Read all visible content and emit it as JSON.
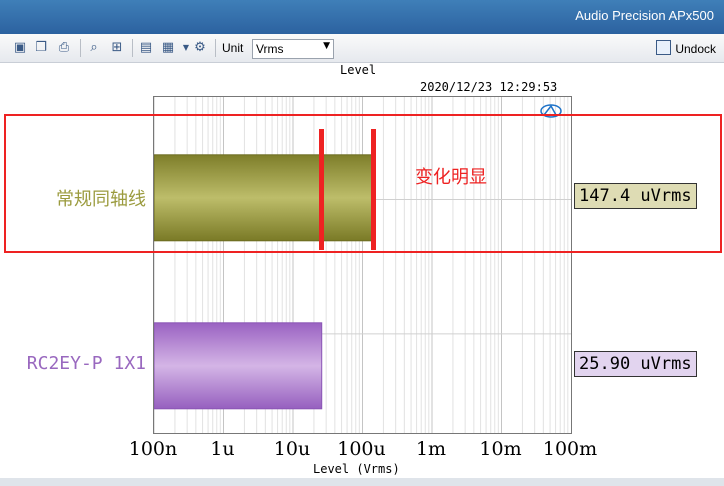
{
  "app": {
    "title": "Audio Precision APx500"
  },
  "toolbar": {
    "icons": [
      "save-icon",
      "copy-icon",
      "print-icon",
      "zoom-icon",
      "fit-icon",
      "table-icon",
      "chart-icon",
      "properties-icon"
    ],
    "unit_label": "Unit",
    "unit_value": "Vrms",
    "undock_label": "Undock"
  },
  "graph": {
    "title": "Level",
    "timestamp": "2020/12/23 12:29:53",
    "logo": "AP"
  },
  "annotation": {
    "text": "变化明显",
    "color": "#ee2222"
  },
  "chart_data": {
    "type": "bar",
    "orientation": "horizontal",
    "title": "Level",
    "xlabel": "Level (Vrms)",
    "x_scale": "log",
    "xlim": [
      1e-07,
      0.1
    ],
    "x_tick_labels": [
      "100n",
      "1u",
      "10u",
      "100u",
      "1m",
      "10m",
      "100m"
    ],
    "grid": true,
    "categories": [
      "常规同轴线",
      "RC2EY-P 1X1"
    ],
    "values": [
      0.0001474,
      2.59e-05
    ],
    "readouts": [
      "147.4 uVrms",
      "25.90 uVrms"
    ],
    "colors": [
      "#9a9a3a",
      "#b27fd0"
    ],
    "label_colors": [
      "#9b9b3e",
      "#9968bf"
    ],
    "readout_backgrounds": [
      "#dedcb4",
      "#e2d4ef"
    ],
    "markers_vrms": [
      2.59e-05,
      0.0001474
    ]
  }
}
